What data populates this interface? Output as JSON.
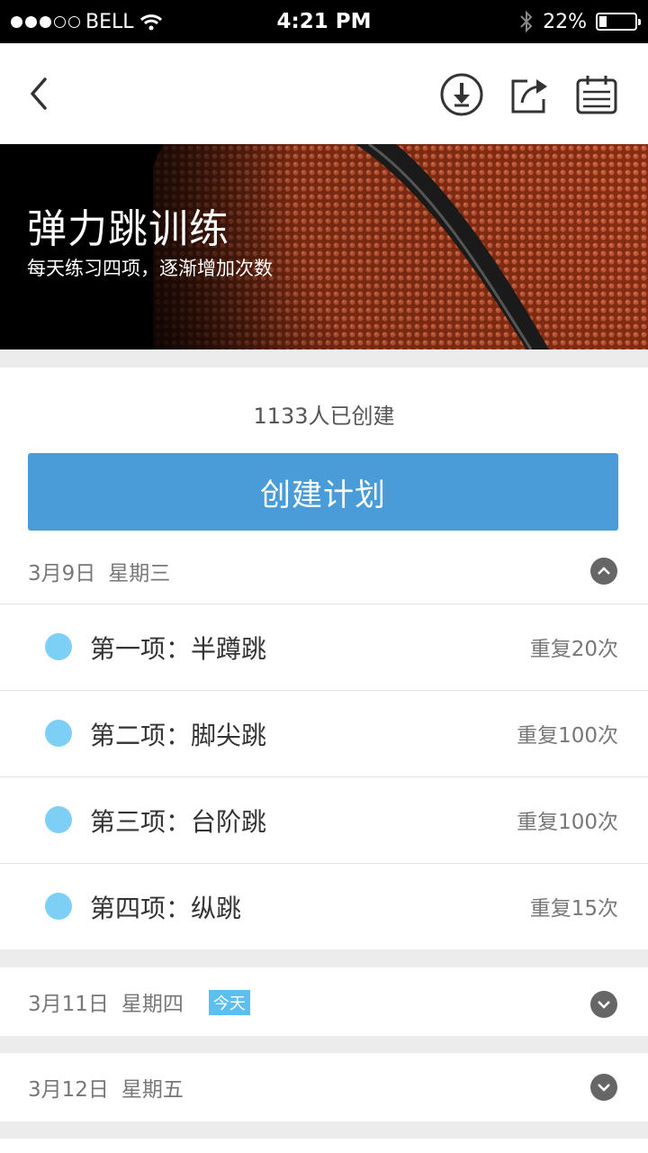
{
  "status_bar": {
    "carrier": "BELL",
    "time": "4:21 PM",
    "battery_percent": "22%",
    "battery_level": 0.22
  },
  "nav": {
    "icons": [
      "back-icon",
      "download-icon",
      "share-icon",
      "calendar-icon"
    ]
  },
  "hero": {
    "title": "弹力跳训练",
    "subtitle": "每天练习四项，逐渐增加次数"
  },
  "plan": {
    "created_count": "1133人已创建",
    "create_button": "创建计划"
  },
  "days": [
    {
      "date": "3月9日",
      "weekday": "星期三",
      "expanded": true,
      "items": [
        {
          "name": "第一项：半蹲跳",
          "reps": "重复20次"
        },
        {
          "name": "第二项：脚尖跳",
          "reps": "重复100次"
        },
        {
          "name": "第三项：台阶跳",
          "reps": "重复100次"
        },
        {
          "name": "第四项：纵跳",
          "reps": "重复15次"
        }
      ]
    },
    {
      "date": "3月11日",
      "weekday": "星期四",
      "badge": "今天",
      "expanded": false
    },
    {
      "date": "3月12日",
      "weekday": "星期五",
      "expanded": false
    }
  ],
  "colors": {
    "accent_button": "#4a9cd8",
    "bullet": "#7dcff5",
    "today_badge": "#5bc0f0",
    "toggle": "#666666"
  }
}
